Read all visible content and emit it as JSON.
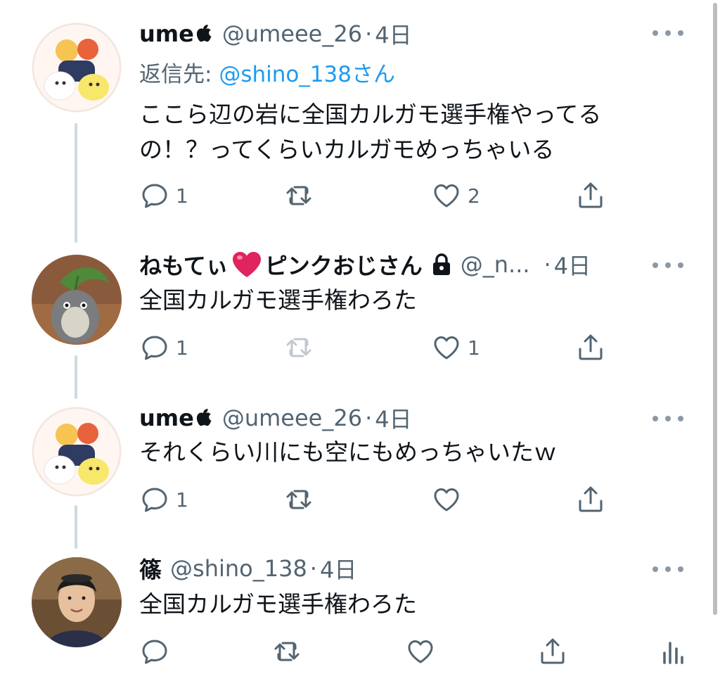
{
  "colors": {
    "accent": "#1d9bf0",
    "secondary_text": "#536471",
    "thread_line": "#cfd9de",
    "heart": "#e0245e"
  },
  "tweets": [
    {
      "name": "ume",
      "badge_icon": "apple-icon",
      "handle": "@umeee_26",
      "separator": "·",
      "time": "4日",
      "reply_prefix": "返信先:",
      "reply_mention": "@shino_138さん",
      "text_line1": "ここら辺の岩に全国カルガモ選手権やってる",
      "text_line2": "の！？ってくらいカルガモめっちゃいる",
      "reply_count": "1",
      "retweet_count": "",
      "like_count": "2"
    },
    {
      "name": "ねもてぃ",
      "name_emoji": "❤️",
      "name_suffix": "ピンクおじさん",
      "badge_icon": "lock-icon",
      "handle": "@_n...",
      "separator": "·",
      "time": "4日",
      "text": "全国カルガモ選手権わろた",
      "reply_count": "1",
      "retweet_count": "",
      "like_count": "1"
    },
    {
      "name": "ume",
      "badge_icon": "apple-icon",
      "handle": "@umeee_26",
      "separator": "·",
      "time": "4日",
      "text": "それくらい川にも空にもめっちゃいたｗ",
      "reply_count": "1",
      "retweet_count": "",
      "like_count": ""
    },
    {
      "name": "篠",
      "handle": "@shino_138",
      "separator": "·",
      "time": "4日",
      "text": "全国カルガモ選手権わろた",
      "reply_count": "",
      "retweet_count": "",
      "like_count": ""
    }
  ]
}
